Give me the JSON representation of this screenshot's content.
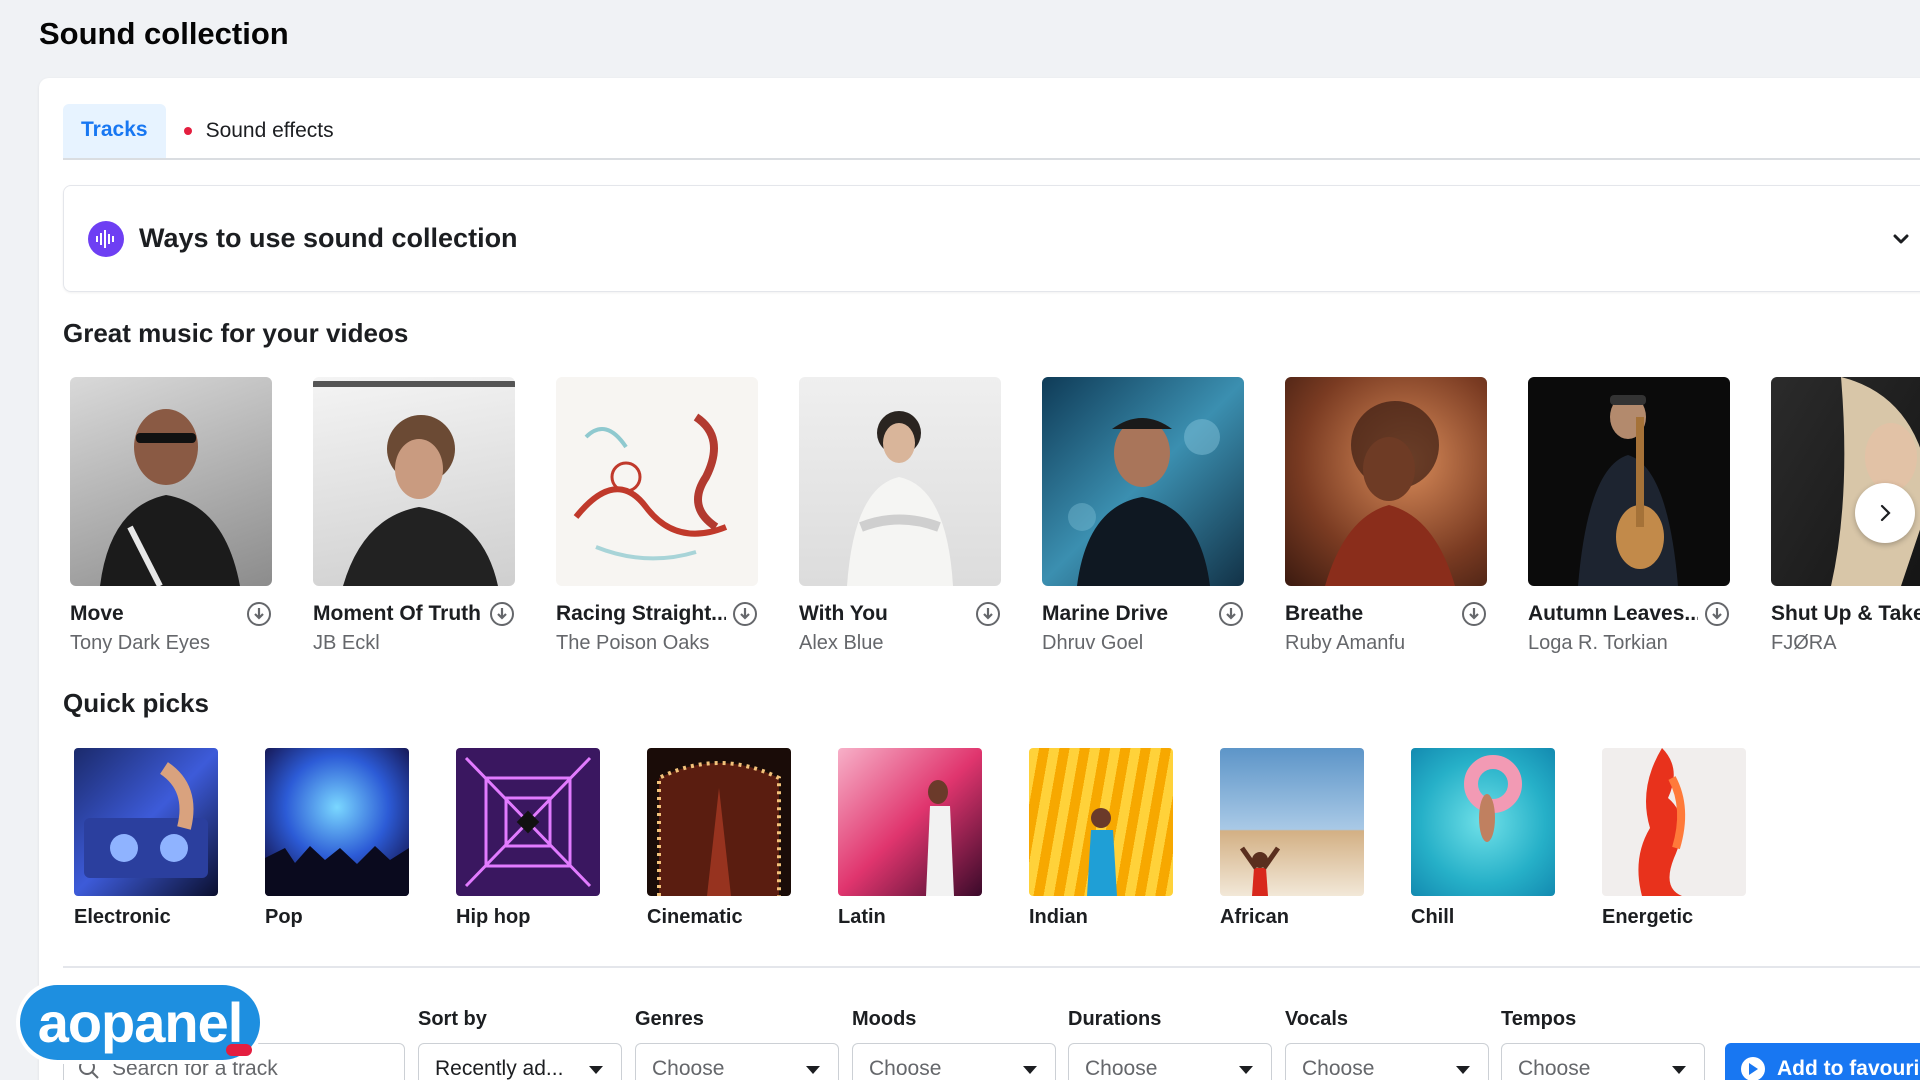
{
  "page_title": "Sound collection",
  "tabs": [
    {
      "label": "Tracks",
      "active": true
    },
    {
      "label": "Sound effects",
      "active": false,
      "notification_dot": true
    }
  ],
  "ways": {
    "title": "Ways to use sound collection",
    "icon": "audio-wave-icon"
  },
  "great_music": {
    "title": "Great music for your videos",
    "tracks": [
      {
        "title": "Move",
        "artist": "Tony Dark Eyes"
      },
      {
        "title": "Moment Of Truth",
        "artist": "JB Eckl"
      },
      {
        "title": "Racing Straight...",
        "artist": "The Poison Oaks"
      },
      {
        "title": "With You",
        "artist": "Alex Blue"
      },
      {
        "title": "Marine Drive",
        "artist": "Dhruv Goel"
      },
      {
        "title": "Breathe",
        "artist": "Ruby Amanfu"
      },
      {
        "title": "Autumn Leaves...",
        "artist": "Loga R. Torkian"
      },
      {
        "title": "Shut Up & Take",
        "artist": "FJØRA"
      }
    ]
  },
  "quick_picks": {
    "title": "Quick picks",
    "items": [
      {
        "label": "Electronic"
      },
      {
        "label": "Pop"
      },
      {
        "label": "Hip hop"
      },
      {
        "label": "Cinematic"
      },
      {
        "label": "Latin"
      },
      {
        "label": "Indian"
      },
      {
        "label": "African"
      },
      {
        "label": "Chill"
      },
      {
        "label": "Energetic"
      }
    ]
  },
  "filters": {
    "search_placeholder": "Search for a track",
    "sort_by": {
      "label": "Sort by",
      "value": "Recently ad..."
    },
    "genres": {
      "label": "Genres",
      "value": "Choose"
    },
    "moods": {
      "label": "Moods",
      "value": "Choose"
    },
    "durations": {
      "label": "Durations",
      "value": "Choose"
    },
    "vocals": {
      "label": "Vocals",
      "value": "Choose"
    },
    "tempos": {
      "label": "Tempos",
      "value": "Choose"
    },
    "add_button": "Add to favouri"
  },
  "logo": {
    "text": "aopanel"
  },
  "colors": {
    "accent": "#1877f2",
    "tab_active_bg": "#e7f3ff",
    "notification_dot": "#e41e3f",
    "ways_icon_bg": "#6e3ff3",
    "logo_bg": "#1e8fe0"
  }
}
